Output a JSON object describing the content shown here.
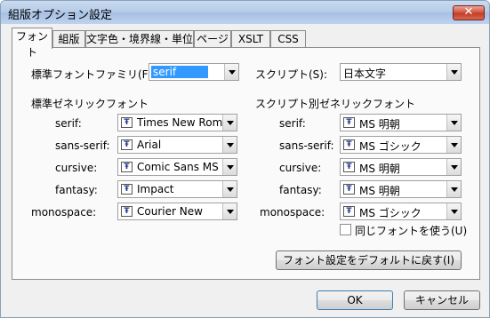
{
  "window": {
    "title": "組版オプション設定",
    "close_label": "✕"
  },
  "tabs": [
    "フォント",
    "組版",
    "文字色・境界線・単位",
    "ページ",
    "XSLT",
    "CSS"
  ],
  "standard_family": {
    "label": "標準フォントファミリ(F):",
    "value": "serif"
  },
  "script": {
    "label": "スクリプト(S):",
    "value": "日本文字"
  },
  "generic_heading": "標準ゼネリックフォント",
  "script_generic_heading": "スクリプト別ゼネリックフォント",
  "generic_fonts": [
    {
      "label": "serif:",
      "value": "Times New Roman"
    },
    {
      "label": "sans-serif:",
      "value": "Arial"
    },
    {
      "label": "cursive:",
      "value": "Comic Sans MS"
    },
    {
      "label": "fantasy:",
      "value": "Impact"
    },
    {
      "label": "monospace:",
      "value": "Courier New"
    }
  ],
  "script_fonts": [
    {
      "label": "serif:",
      "value": "MS 明朝"
    },
    {
      "label": "sans-serif:",
      "value": "MS ゴシック"
    },
    {
      "label": "cursive:",
      "value": "MS 明朝"
    },
    {
      "label": "fantasy:",
      "value": "MS 明朝"
    },
    {
      "label": "monospace:",
      "value": "MS ゴシック"
    }
  ],
  "same_font_checkbox": {
    "label": "同じフォントを使う(U)",
    "checked": false
  },
  "reset_button": "フォント設定をデフォルトに戻す(I)",
  "ok_button": "OK",
  "cancel_button": "キャンセル",
  "font_icon_glyph": "Ŧ"
}
